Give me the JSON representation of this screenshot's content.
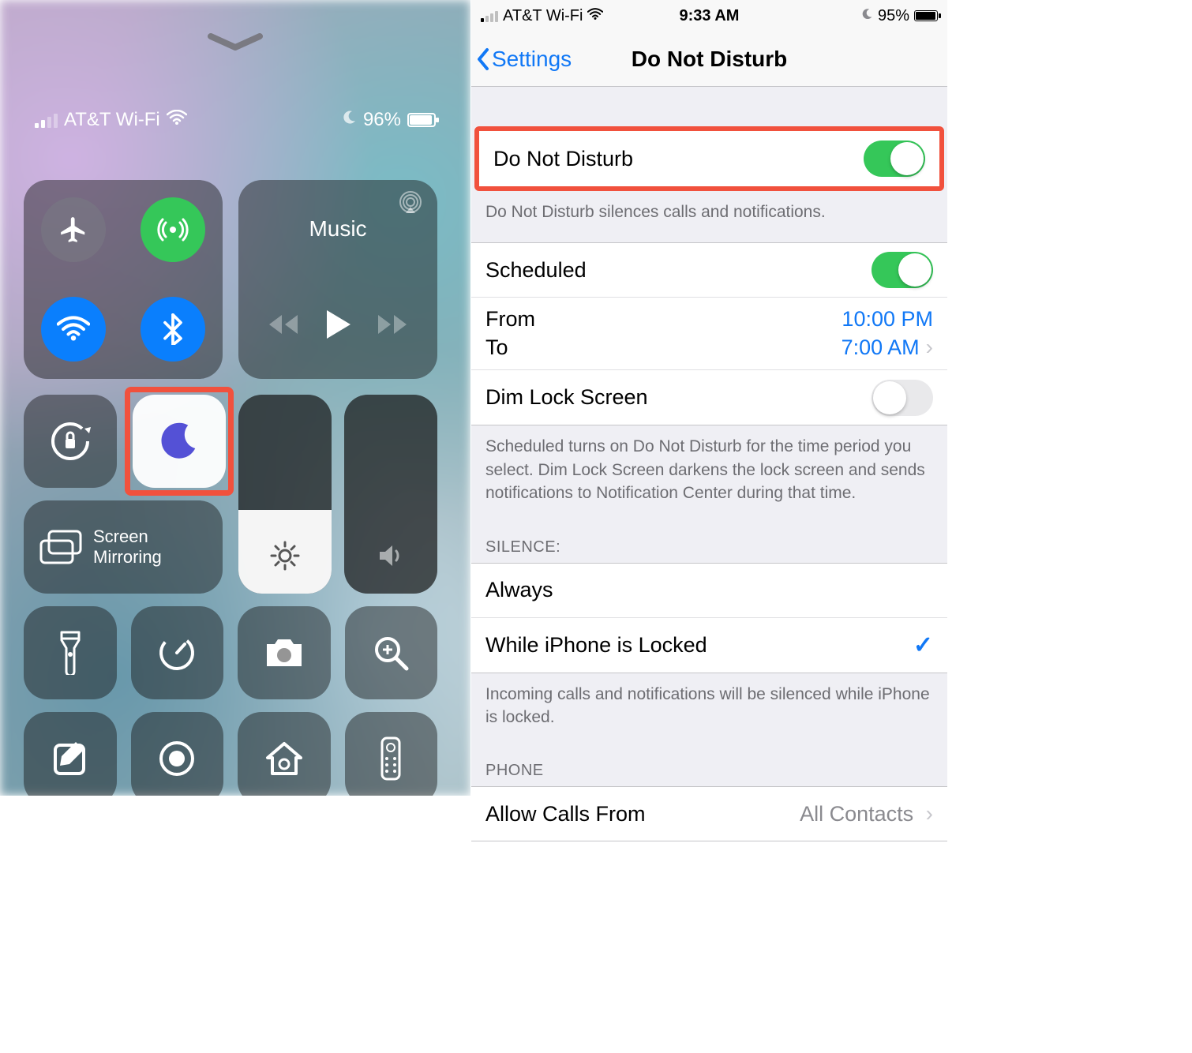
{
  "left": {
    "carrier": "AT&T Wi-Fi",
    "battery_pct": "96%",
    "music_title": "Music",
    "screen_mirror_l1": "Screen",
    "screen_mirror_l2": "Mirroring"
  },
  "right": {
    "status": {
      "carrier": "AT&T Wi-Fi",
      "time": "9:33 AM",
      "battery_pct": "95%"
    },
    "nav": {
      "back": "Settings",
      "title": "Do Not Disturb"
    },
    "dnd": {
      "label": "Do Not Disturb",
      "on": true,
      "footer": "Do Not Disturb silences calls and notifications."
    },
    "scheduled": {
      "label": "Scheduled",
      "on": true,
      "from_label": "From",
      "from_value": "10:00 PM",
      "to_label": "To",
      "to_value": "7:00 AM",
      "dim_label": "Dim Lock Screen",
      "dim_on": false,
      "footer": "Scheduled turns on Do Not Disturb for the time period you select. Dim Lock Screen darkens the lock screen and sends notifications to Notification Center during that time."
    },
    "silence": {
      "header": "SILENCE:",
      "always": "Always",
      "locked": "While iPhone is Locked",
      "selected": "locked",
      "footer": "Incoming calls and notifications will be silenced while iPhone is locked."
    },
    "phone": {
      "header": "PHONE",
      "allow_label": "Allow Calls From",
      "allow_value": "All Contacts"
    }
  }
}
